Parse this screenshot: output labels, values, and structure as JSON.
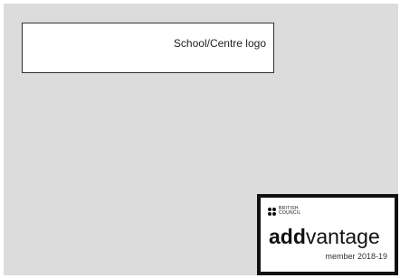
{
  "school_logo": {
    "label": "School/Centre logo"
  },
  "badge": {
    "org_line1": "BRITISH",
    "org_line2": "COUNCIL",
    "brand_bold": "add",
    "brand_light": "vantage",
    "member_text": "member 2018-19"
  },
  "colors": {
    "page_background": "#ffffff",
    "canvas_background": "#dcdcdc",
    "badge_border": "#111111"
  }
}
